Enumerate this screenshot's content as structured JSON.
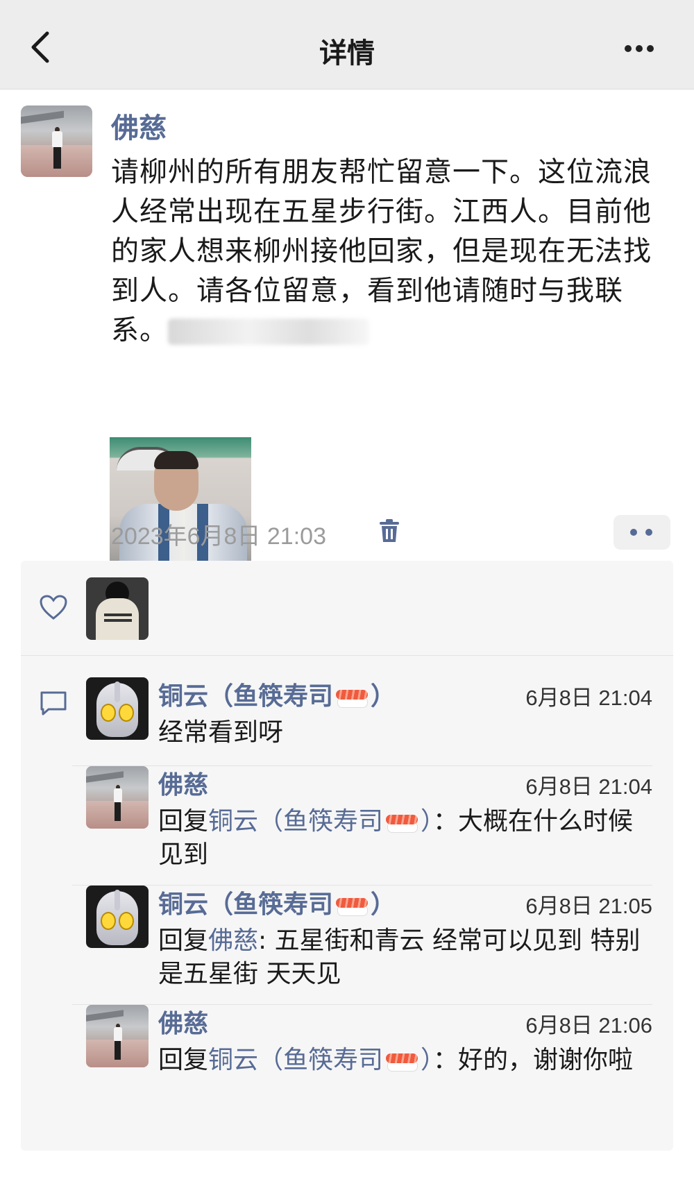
{
  "header": {
    "title": "详情",
    "back_icon": "chevron-left-icon",
    "more_icon": "more-horizontal-icon"
  },
  "post": {
    "author": "佛慈",
    "text_main": "请柳州的所有朋友帮忙留意一下。这位流浪人经常出现在五星步行街。江西人。目前他的家人想来柳州接他回家，但是现在无法找到人。请各位留意，看到他请随时与我联系。",
    "time": "2023年6月8日 21:03",
    "delete_icon": "trash-icon",
    "action_icon": "more-dots-icon"
  },
  "likes": {
    "icon": "heart-icon"
  },
  "comments": {
    "icon": "comment-icon",
    "items": [
      {
        "author": "铜云（鱼筷寿司",
        "author_suffix": "）",
        "time": "6月8日 21:04",
        "text": "经常看到呀"
      },
      {
        "author": "佛慈",
        "time": "6月8日 21:04",
        "reply_prefix": "回复",
        "reply_to": "铜云（鱼筷寿司",
        "reply_to_suffix": "）",
        "text": "：大概在什么时候见到"
      },
      {
        "author": "铜云（鱼筷寿司",
        "author_suffix": "）",
        "time": "6月8日 21:05",
        "reply_prefix": "回复",
        "reply_to": "佛慈",
        "text": ": 五星街和青云 经常可以见到 特别是五星街 天天见"
      },
      {
        "author": "佛慈",
        "time": "6月8日 21:06",
        "reply_prefix": "回复",
        "reply_to": "铜云（鱼筷寿司",
        "reply_to_suffix": "）",
        "text": "：好的，谢谢你啦"
      }
    ]
  },
  "colors": {
    "link": "#576b95",
    "header_bg": "#ededed",
    "panel_bg": "#f6f6f6",
    "time_gray": "#9b9b9b"
  }
}
